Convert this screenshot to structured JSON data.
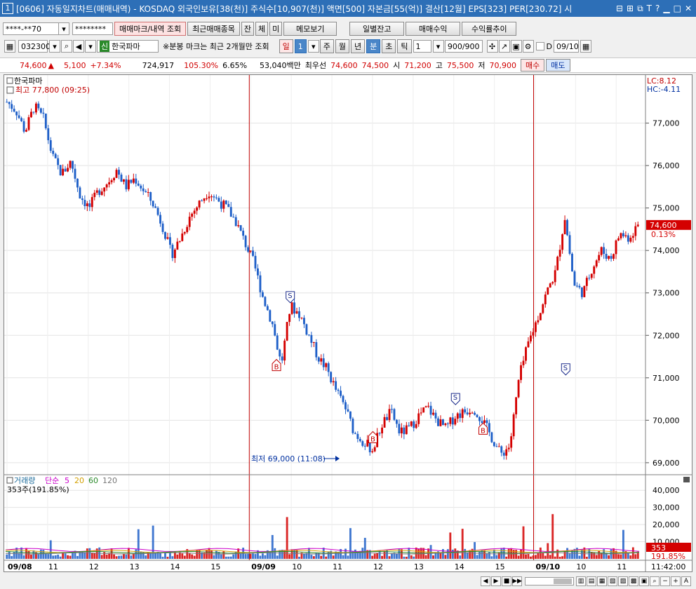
{
  "window": {
    "number": "1",
    "title": "[0606] 자동일지차트(매매내역) - KOSDAQ 외국인보유[38(천)] 주식수[10,907(천)] 액면[500] 자본금[55(억)] 결산[12월] EPS[323] PER[230.72] 시"
  },
  "toolbar1": {
    "account": "****-**70",
    "password": "********",
    "btn_markview": "매매마크/내역 조회",
    "btn_recent": "최근매매종목",
    "btn_jan": "잔",
    "btn_che": "체",
    "btn_mi": "미",
    "btn_memo": "메모보기",
    "btn_daily": "일별잔고",
    "btn_profit": "매매수익",
    "btn_rate": "수익률추이"
  },
  "toolbar2": {
    "code": "032300",
    "badge": "신",
    "name": "한국파마",
    "note": "※분봉 마크는 최근 2개월만 조회",
    "period_day": "일",
    "period_num": "1",
    "period_week": "주",
    "period_month": "월",
    "period_year": "년",
    "period_min": "분",
    "period_sec": "초",
    "period_tick": "틱",
    "interval": "1",
    "count": "900/900",
    "d_label": "D",
    "date": "09/10"
  },
  "quote": {
    "price": "74,600",
    "arrow": "▲",
    "change": "5,100",
    "rate": "+7.34%",
    "volume": "724,917",
    "vol_ratio": "105.30%",
    "turnover": "6.65%",
    "amount": "53,040백만",
    "best_label": "최우선",
    "best_ask": "74,600",
    "best_bid": "74,500",
    "open_label": "시",
    "open": "71,200",
    "high_label": "고",
    "high": "75,500",
    "low_label": "저",
    "low": "70,900",
    "buy": "매수",
    "sell": "매도"
  },
  "chart_data": {
    "type": "candlestick",
    "stock_name": "한국파마",
    "high_note": "최고 77,800 (09:25)",
    "low_note": "최저 69,000 (11:08)",
    "lc": "LC:8.12",
    "hc": "HC:-4.11",
    "last_price": "74,600",
    "last_rate": "0.13%",
    "ylim": [
      68800,
      78000
    ],
    "y_ticks": [
      "77,000",
      "76,000",
      "75,000",
      "74,000",
      "73,000",
      "72,000",
      "71,000",
      "70,000",
      "69,000"
    ],
    "x_labels": [
      "09/08",
      "11",
      "12",
      "13",
      "14",
      "15",
      "09/09",
      "10",
      "11",
      "12",
      "13",
      "14",
      "15",
      "09/10",
      "10",
      "11"
    ],
    "time_label": "11:42:00",
    "close_series": [
      77500,
      77300,
      76800,
      77400,
      77100,
      76200,
      75800,
      76100,
      75300,
      75000,
      75400,
      75600,
      75900,
      75500,
      75700,
      75400,
      75100,
      74600,
      73900,
      74300,
      74800,
      75100,
      75400,
      75200,
      75000,
      74700,
      74200,
      73700,
      72900,
      72300,
      71300,
      72700,
      72500,
      72000,
      71500,
      71200,
      70700,
      70300,
      69700,
      69500,
      69300,
      69900,
      70200,
      69700,
      69800,
      70100,
      70300,
      70000,
      69800,
      70100,
      70200,
      70300,
      70000,
      69600,
      69200,
      69400,
      71000,
      71800,
      72400,
      73000,
      73500,
      74800,
      73200,
      73000,
      73600,
      74000,
      73800,
      74400,
      74300,
      74600
    ],
    "marks": [
      {
        "type": "B",
        "label": "B",
        "price": 71400,
        "idx": 29.5
      },
      {
        "type": "S",
        "label": "S",
        "price": 72800,
        "idx": 31
      },
      {
        "type": "B",
        "label": "B",
        "price": 69700,
        "idx": 40
      },
      {
        "type": "S",
        "label": "S",
        "price": 70400,
        "idx": 49
      },
      {
        "type": "B",
        "label": "B",
        "price": 69900,
        "idx": 52
      },
      {
        "type": "S",
        "label": "S",
        "price": 71100,
        "idx": 61
      }
    ],
    "volume": {
      "title": "거래량",
      "ma_label": "단순",
      "ma5": "5",
      "ma20": "20",
      "ma60": "60",
      "ma120": "120",
      "current": "353주(191.85%)",
      "last_value": "353",
      "last_rate": "191.85%",
      "ylim": [
        0,
        45000
      ],
      "y_ticks": [
        "40,000",
        "30,000",
        "20,000",
        "10,000"
      ]
    },
    "colors": {
      "up": "#d40000",
      "down": "#1e5fc8",
      "vline": "#c00000",
      "ma5": "#cc00cc",
      "ma20": "#d4a000",
      "ma60": "#2a8a2a",
      "ma120": "#777777"
    }
  }
}
